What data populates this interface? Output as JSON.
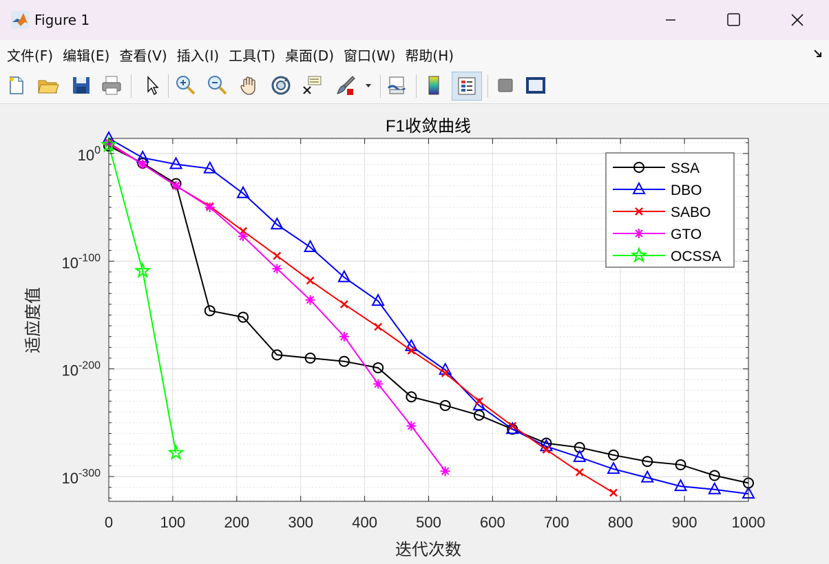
{
  "window": {
    "title": "Figure 1",
    "minimize_label": "—",
    "maximize_label": "☐",
    "close_label": "✕"
  },
  "menu": {
    "items": [
      "文件(F)",
      "编辑(E)",
      "查看(V)",
      "插入(I)",
      "工具(T)",
      "桌面(D)",
      "窗口(W)",
      "帮助(H)"
    ]
  },
  "toolbar": {
    "buttons": [
      "new-figure-icon",
      "open-file-icon",
      "save-icon",
      "print-icon",
      "pointer-icon",
      "zoom-in-icon",
      "zoom-out-icon",
      "pan-icon",
      "rotate-3d-icon",
      "data-cursor-icon",
      "brush-icon",
      "link-plot-icon",
      "colorbar-icon",
      "legend-icon",
      "hide-plot-tools-icon",
      "show-plot-tools-icon"
    ]
  },
  "colors": {
    "SSA": "#000000",
    "DBO": "#0000ff",
    "SABO": "#ff0000",
    "GTO": "#ff00ff",
    "OCSSA": "#00ff00"
  },
  "chart_data": {
    "type": "line",
    "title": "F1收敛曲线",
    "xlabel": "迭代次数",
    "ylabel": "适应度值",
    "xlim": [
      0,
      1000
    ],
    "ylim_log10": [
      -323,
      14
    ],
    "yscale": "log",
    "grid": true,
    "legend_position": "top-right",
    "xticks": [
      "0",
      "100",
      "200",
      "300",
      "400",
      "500",
      "600",
      "700",
      "800",
      "900",
      "1000"
    ],
    "yticks": [
      {
        "base": "10",
        "exp": "0",
        "log10": 0
      },
      {
        "base": "10",
        "exp": "-100",
        "log10": -100
      },
      {
        "base": "10",
        "exp": "-200",
        "log10": -200
      },
      {
        "base": "10",
        "exp": "-300",
        "log10": -300
      }
    ],
    "series": [
      {
        "name": "SSA",
        "marker": "o",
        "x": [
          0,
          53,
          105,
          158,
          210,
          263,
          315,
          368,
          421,
          473,
          526,
          579,
          631,
          684,
          736,
          789,
          842,
          894,
          947,
          1000
        ],
        "log10y": [
          7,
          -9,
          -28,
          -146,
          -152,
          -187,
          -190,
          -193,
          -199,
          -226,
          -234,
          -243,
          -256,
          -269,
          -273,
          -280,
          -286,
          -289,
          -299,
          -306
        ]
      },
      {
        "name": "DBO",
        "marker": "^",
        "x": [
          0,
          53,
          105,
          158,
          210,
          263,
          315,
          368,
          421,
          473,
          526,
          579,
          631,
          684,
          736,
          789,
          842,
          894,
          947,
          1000
        ],
        "log10y": [
          14,
          -4,
          -10,
          -14,
          -37,
          -66,
          -87,
          -115,
          -137,
          -179,
          -201,
          -234,
          -256,
          -272,
          -282,
          -293,
          -301,
          -309,
          -312,
          -316
        ]
      },
      {
        "name": "SABO",
        "marker": "x",
        "x": [
          0,
          53,
          105,
          158,
          210,
          263,
          315,
          368,
          421,
          473,
          526,
          579,
          631,
          684,
          736,
          789
        ],
        "log10y": [
          10,
          -10,
          -30,
          -49,
          -72,
          -95,
          -118,
          -140,
          -161,
          -183,
          -204,
          -230,
          -253,
          -275,
          -296,
          -315
        ]
      },
      {
        "name": "GTO",
        "marker": "*",
        "x": [
          0,
          53,
          105,
          158,
          210,
          263,
          315,
          368,
          421,
          473,
          526
        ],
        "log10y": [
          9,
          -10,
          -30,
          -50,
          -77,
          -107,
          -136,
          -170,
          -214,
          -253,
          -295
        ]
      },
      {
        "name": "OCSSA",
        "marker": "pentagram",
        "x": [
          0,
          53,
          105
        ],
        "log10y": [
          8,
          -109,
          -278
        ]
      }
    ]
  }
}
